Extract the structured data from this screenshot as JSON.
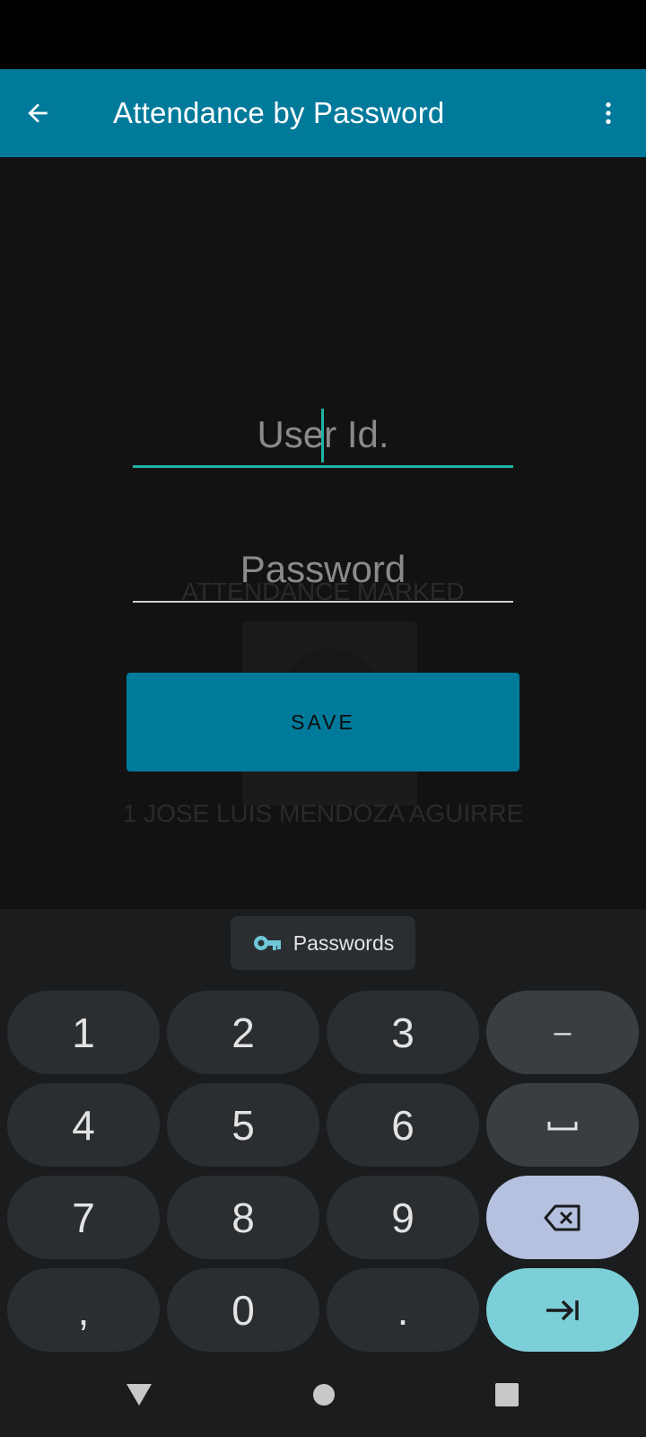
{
  "app_bar": {
    "title": "Attendance by Password",
    "back_icon": "arrow-back-icon",
    "more_icon": "more-vert-icon",
    "color": "#007a9b"
  },
  "form": {
    "user_id": {
      "placeholder": "User Id.",
      "value": ""
    },
    "password": {
      "placeholder": "Password",
      "value": ""
    },
    "save_label": "SAVE",
    "accent": "#20b3a3"
  },
  "background": {
    "caption_top": "ATTENDANCE MARKED",
    "caption_bottom": "1 JOSE LUIS MENDOZA AGUIRRE"
  },
  "keyboard": {
    "suggestion": {
      "icon": "key-icon",
      "label": "Passwords"
    },
    "rows": [
      [
        "1",
        "2",
        "3",
        "–"
      ],
      [
        "4",
        "5",
        "6",
        "␣"
      ],
      [
        "7",
        "8",
        "9",
        "⌫"
      ],
      [
        ",",
        "0",
        ".",
        "⇥"
      ]
    ]
  },
  "nav_bar": {
    "back_icon": "nav-back-triangle-icon",
    "home_icon": "nav-home-circle-icon",
    "recents_icon": "nav-recents-square-icon"
  }
}
